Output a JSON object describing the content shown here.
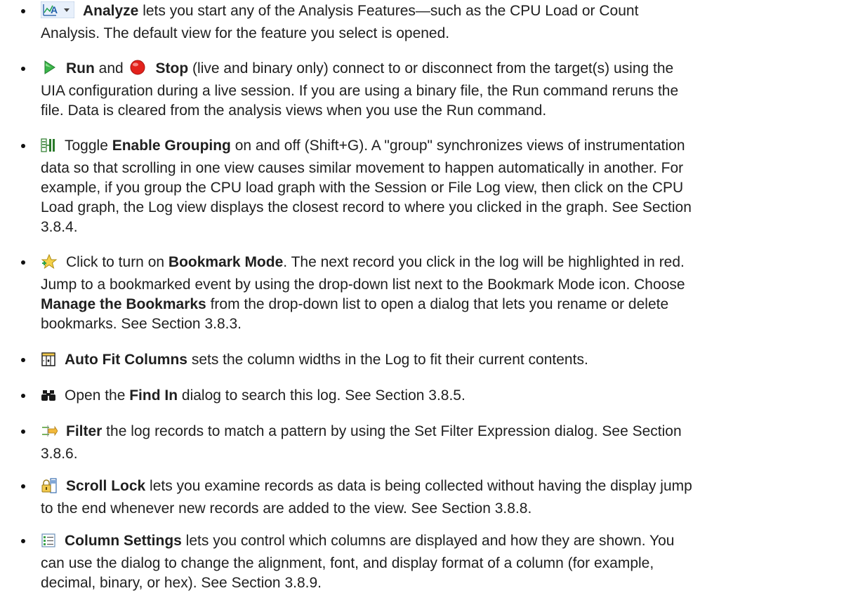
{
  "items": [
    {
      "icon": "analyze-chart-icon",
      "l1_bold": "Analyze",
      "l1_rest": " lets you start any of the Analysis Features—such as the CPU Load or Count",
      "l2": "Analysis. The default view for the feature you select is opened."
    },
    {
      "icon": "run-play-icon",
      "run": "Run",
      "and": " and ",
      "stop_icon": "stop-red-dot-icon",
      "stop": "Stop",
      "l1_rest": " (live and binary only) connect to or disconnect from the target(s) using the",
      "l2": "UIA configuration during a live session. If you are using a binary file, the Run command reruns the",
      "l3": "file. Data is cleared from the analysis views when you use the Run command."
    },
    {
      "icon": "enable-grouping-icon",
      "pre": "Toggle ",
      "bold": "Enable Grouping",
      "l1_rest": " on and off (Shift+G). A \"group\" synchronizes views of instrumentation",
      "l2": "data so that scrolling in one view causes similar movement to happen automatically in another. For",
      "l3": "example, if you group the CPU load graph with the Session or File Log view, then click on the CPU",
      "l4": "Load graph, the Log view displays the closest record to where you clicked in the graph. See Section",
      "l5": "3.8.4."
    },
    {
      "icon": "bookmark-star-icon",
      "pre": "Click to turn on ",
      "bold": "Bookmark Mode",
      "l1_rest": ". The next record you click in the log will be highlighted in red.",
      "l2": "Jump to a bookmarked event by using the drop-down list next to the Bookmark Mode icon. Choose",
      "l3_bold": "Manage the Bookmarks",
      "l3_rest": " from the drop-down list to open a dialog that lets you rename or delete",
      "l4": "bookmarks. See Section 3.8.3."
    },
    {
      "icon": "auto-fit-columns-icon",
      "bold": "Auto Fit Columns",
      "rest": " sets the column widths in the Log to fit their current contents."
    },
    {
      "icon": "binoculars-find-icon",
      "pre": "Open the ",
      "bold": "Find In",
      "rest": " dialog to search this log. See Section 3.8.5."
    },
    {
      "icon": "filter-arrows-icon",
      "bold": "Filter",
      "l1_rest": " the log records to match a pattern by using the Set Filter Expression dialog. See Section",
      "l2": "3.8.6."
    },
    {
      "icon": "scroll-lock-icon",
      "bold": "Scroll Lock",
      "l1_rest": " lets you examine records as data is being collected without having the display jump",
      "l2": "to the end whenever new records are added to the view. See Section 3.8.8."
    },
    {
      "icon": "column-settings-icon",
      "bold": "Column Settings",
      "l1_rest": " lets you control which columns are displayed and how they are shown. You",
      "l2": "can use the dialog to change the alignment, font, and display format of a column (for example,",
      "l3": "decimal, binary, or hex). See Section 3.8.9."
    }
  ]
}
